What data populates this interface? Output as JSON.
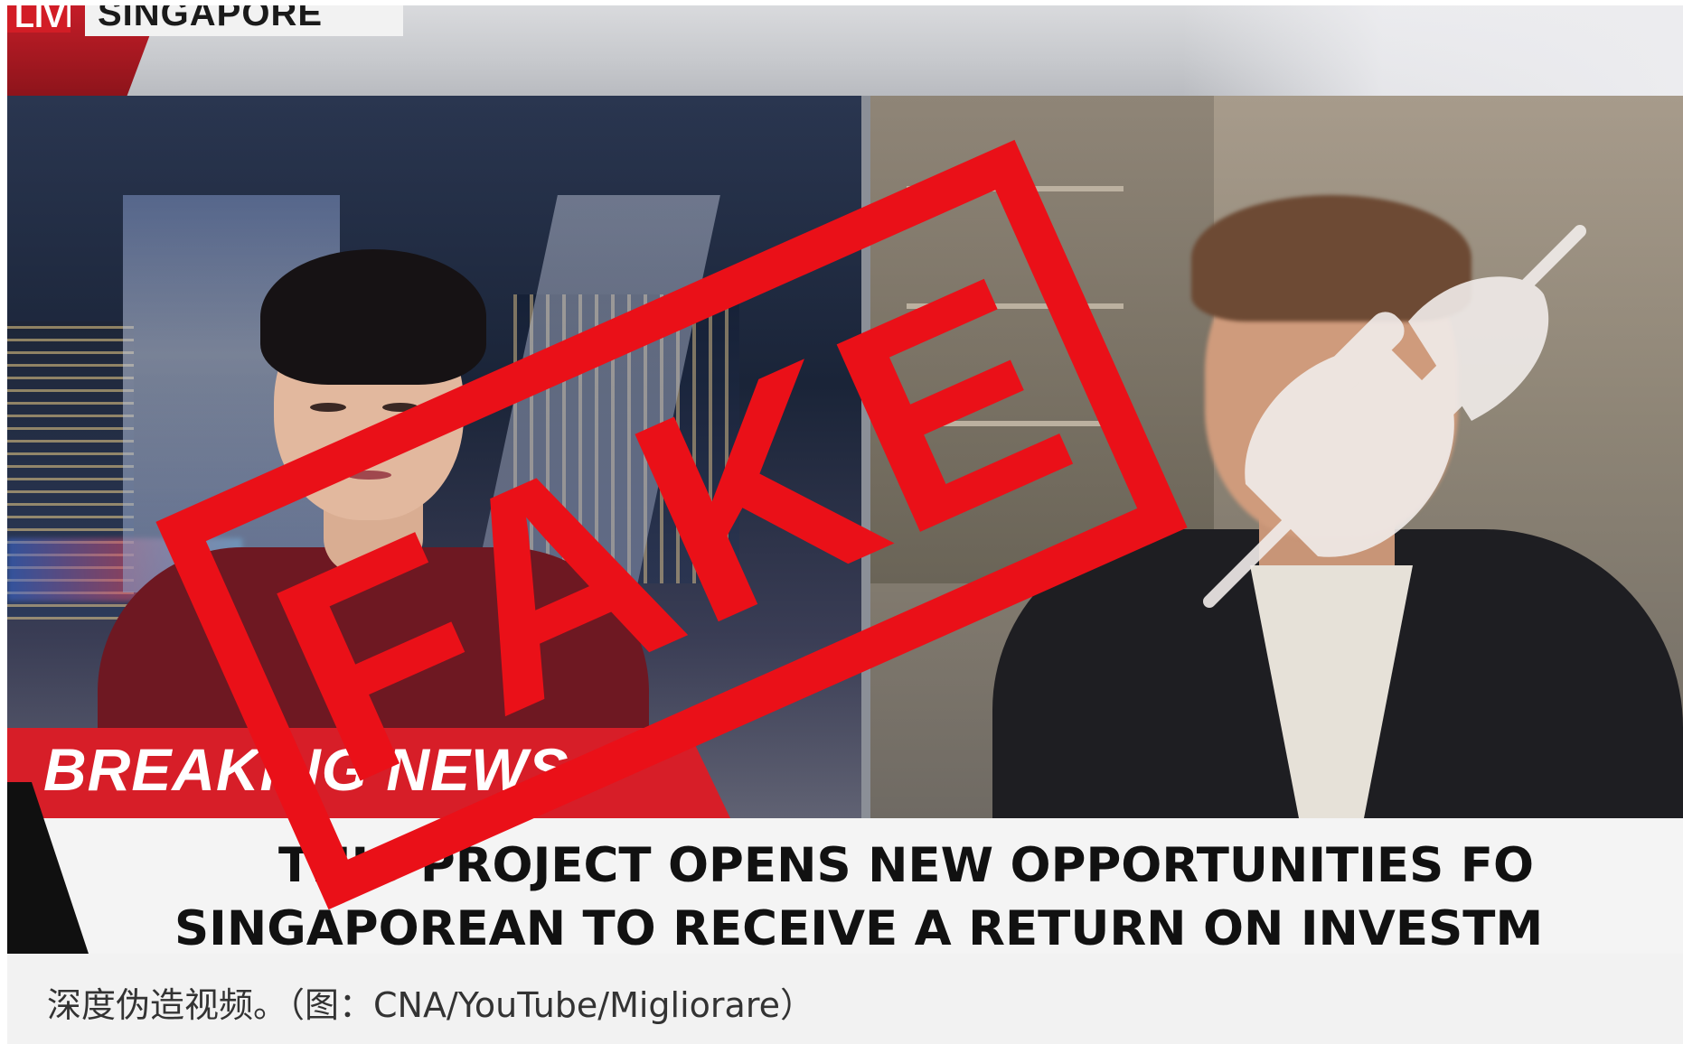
{
  "broadcast": {
    "live_label": "LIVE",
    "location": "SINGAPORE",
    "breaking_label": "BREAKING NEWS",
    "ticker_line_1": "THIS PROJECT OPENS NEW OPPORTUNITIES FO",
    "ticker_line_2": "SINGAPOREAN TO RECEIVE A RETURN ON INVESTM"
  },
  "overlay": {
    "stamp_text": "FAKE",
    "stamp_color": "#ea1018",
    "icon": "unplugged-plug-icon"
  },
  "caption": {
    "text": "深度伪造视频。（图：CNA/YouTube/Migliorare）"
  },
  "colors": {
    "breaking_red": "#d71e28",
    "caption_bg": "#f2f2f2"
  }
}
